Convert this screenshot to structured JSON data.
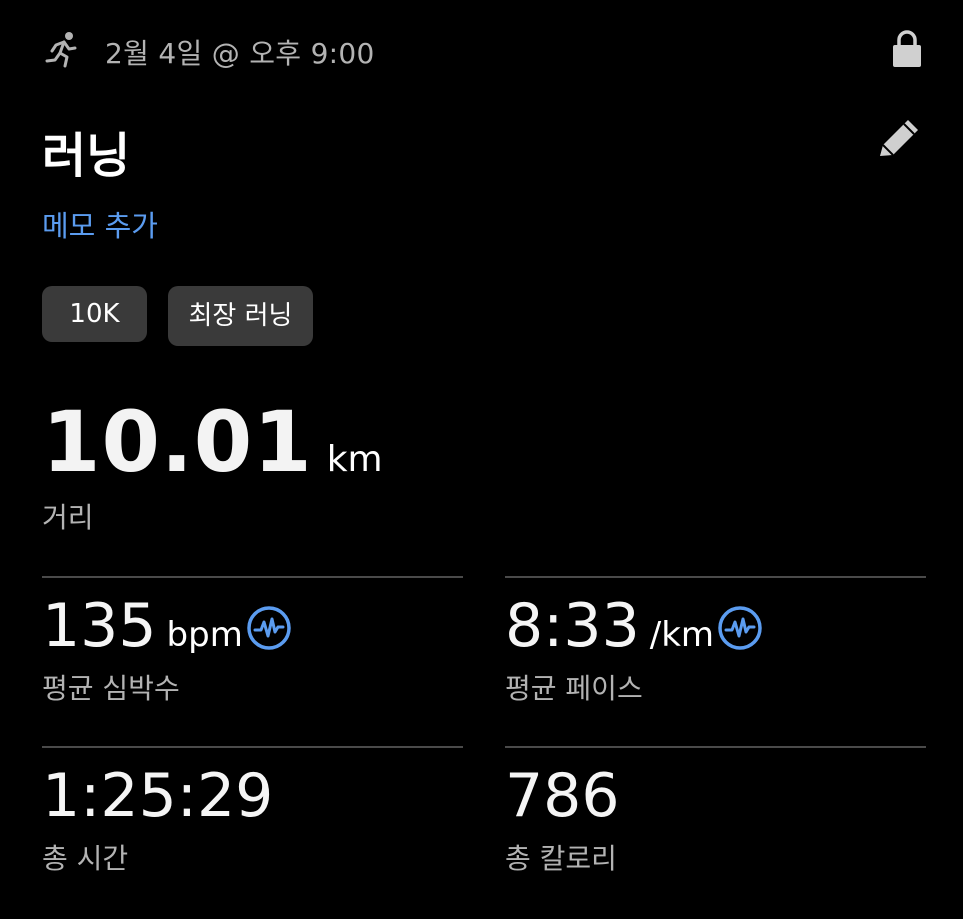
{
  "header": {
    "datetime": "2월 4일 @ 오후 9:00",
    "activity_icon": "running-icon",
    "lock_icon": "lock-icon"
  },
  "activity": {
    "title": "러닝",
    "edit_icon": "pencil-icon",
    "memo_link": "메모 추가"
  },
  "tags": [
    "10K",
    "최장 러닝"
  ],
  "distance": {
    "value": "10.01",
    "unit": "km",
    "label": "거리"
  },
  "metrics": [
    {
      "value": "135",
      "unit": "bpm",
      "label": "평균 심박수",
      "icon": "heart-rate-chart-icon"
    },
    {
      "value": "8:33",
      "unit": "/km",
      "label": "평균 페이스",
      "icon": "pace-chart-icon"
    },
    {
      "value": "1:25:29",
      "unit": "",
      "label": "총 시간"
    },
    {
      "value": "786",
      "unit": "",
      "label": "총 칼로리"
    }
  ],
  "colors": {
    "background": "#000000",
    "accent": "#5b9cf0",
    "tag_background": "#3a3a3a",
    "secondary_text": "#b3b3b3"
  }
}
